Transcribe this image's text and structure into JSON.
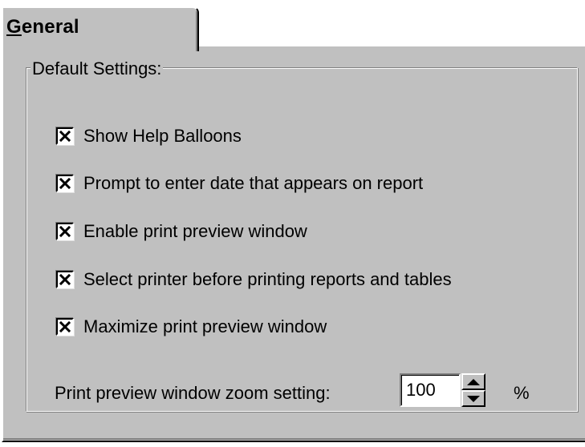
{
  "tab": {
    "label_mnemonic": "G",
    "label_rest": "eneral"
  },
  "group": {
    "title": "Default Settings:"
  },
  "options": [
    {
      "label": "Show Help Balloons",
      "checked": true
    },
    {
      "label": "Prompt to enter date that appears on report",
      "checked": true
    },
    {
      "label": "Enable print preview window",
      "checked": true
    },
    {
      "label": "Select printer before printing reports and tables",
      "checked": true
    },
    {
      "label": "Maximize print preview window",
      "checked": true
    }
  ],
  "zoom": {
    "label": "Print preview window zoom setting:",
    "value": "100",
    "unit": "%"
  },
  "colors": {
    "face": "#c0c0c0",
    "highlight": "#ffffff",
    "shadow": "#808080",
    "dark_shadow": "#000000"
  }
}
